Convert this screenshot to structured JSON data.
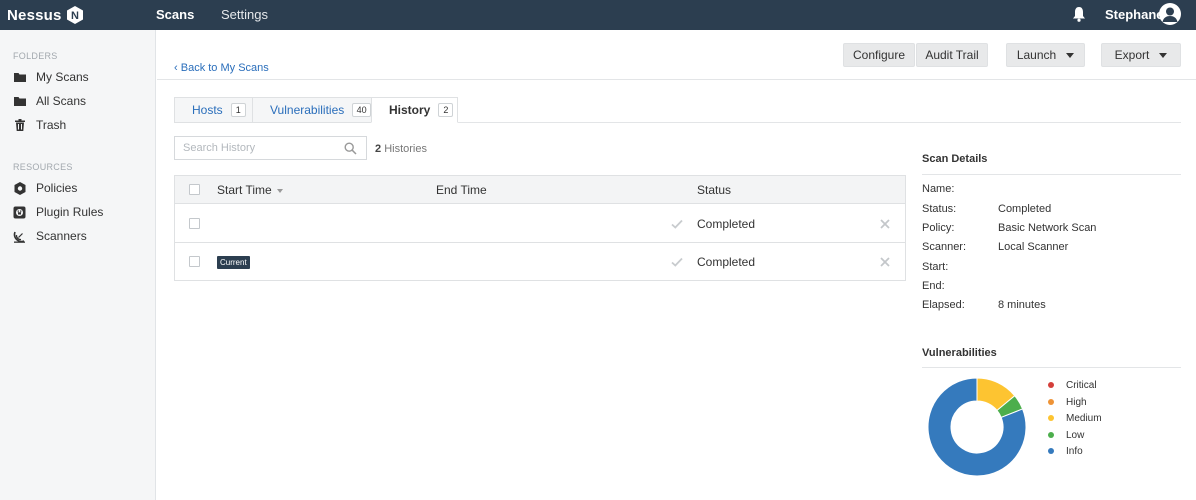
{
  "app": {
    "logo_text": "Nessus",
    "logo_badge": "N"
  },
  "nav": {
    "scans": "Scans",
    "settings": "Settings",
    "username": "Stephane"
  },
  "sidebar": {
    "folders_header": "FOLDERS",
    "folders": [
      {
        "label": "My Scans",
        "icon": "folder-icon"
      },
      {
        "label": "All Scans",
        "icon": "folder-icon"
      },
      {
        "label": "Trash",
        "icon": "trash-icon"
      }
    ],
    "resources_header": "RESOURCES",
    "resources": [
      {
        "label": "Policies",
        "icon": "shield-icon"
      },
      {
        "label": "Plugin Rules",
        "icon": "plugin-icon"
      },
      {
        "label": "Scanners",
        "icon": "satellite-dish-icon"
      }
    ]
  },
  "toolbar": {
    "back": "Back to My Scans",
    "configure": "Configure",
    "audit_trail": "Audit Trail",
    "launch": "Launch",
    "export": "Export"
  },
  "tabs": [
    {
      "label": "Hosts",
      "count": "1"
    },
    {
      "label": "Vulnerabilities",
      "count": "40"
    },
    {
      "label": "History",
      "count": "2"
    }
  ],
  "search": {
    "placeholder": "Search History",
    "value": ""
  },
  "history_count": {
    "number": "2",
    "label": "Histories"
  },
  "table": {
    "columns": [
      "Start Time",
      "End Time",
      "Status"
    ],
    "rows": [
      {
        "badge": "",
        "status": "Completed"
      },
      {
        "badge": "Current",
        "status": "Completed"
      }
    ]
  },
  "scan_details": {
    "title": "Scan Details",
    "fields": [
      {
        "key": "Name:",
        "value": ""
      },
      {
        "key": "Status:",
        "value": "Completed"
      },
      {
        "key": "Policy:",
        "value": "Basic Network Scan"
      },
      {
        "key": "Scanner:",
        "value": "Local Scanner"
      },
      {
        "key": "Start:",
        "value": ""
      },
      {
        "key": "End:",
        "value": ""
      },
      {
        "key": "Elapsed:",
        "value": "8 minutes"
      }
    ]
  },
  "vulnerabilities": {
    "title": "Vulnerabilities",
    "legend": [
      {
        "label": "Critical",
        "color": "#d43f3a"
      },
      {
        "label": "High",
        "color": "#ee9336"
      },
      {
        "label": "Medium",
        "color": "#fdc431"
      },
      {
        "label": "Low",
        "color": "#4cae4c"
      },
      {
        "label": "Info",
        "color": "#357abd"
      }
    ]
  },
  "chart_data": {
    "type": "pie",
    "categories": [
      "Critical",
      "High",
      "Medium",
      "Low",
      "Info"
    ],
    "values": [
      0,
      0,
      14,
      5,
      81
    ],
    "colors": [
      "#d43f3a",
      "#ee9336",
      "#fdc431",
      "#4cae4c",
      "#357abd"
    ],
    "legend_position": "right"
  }
}
